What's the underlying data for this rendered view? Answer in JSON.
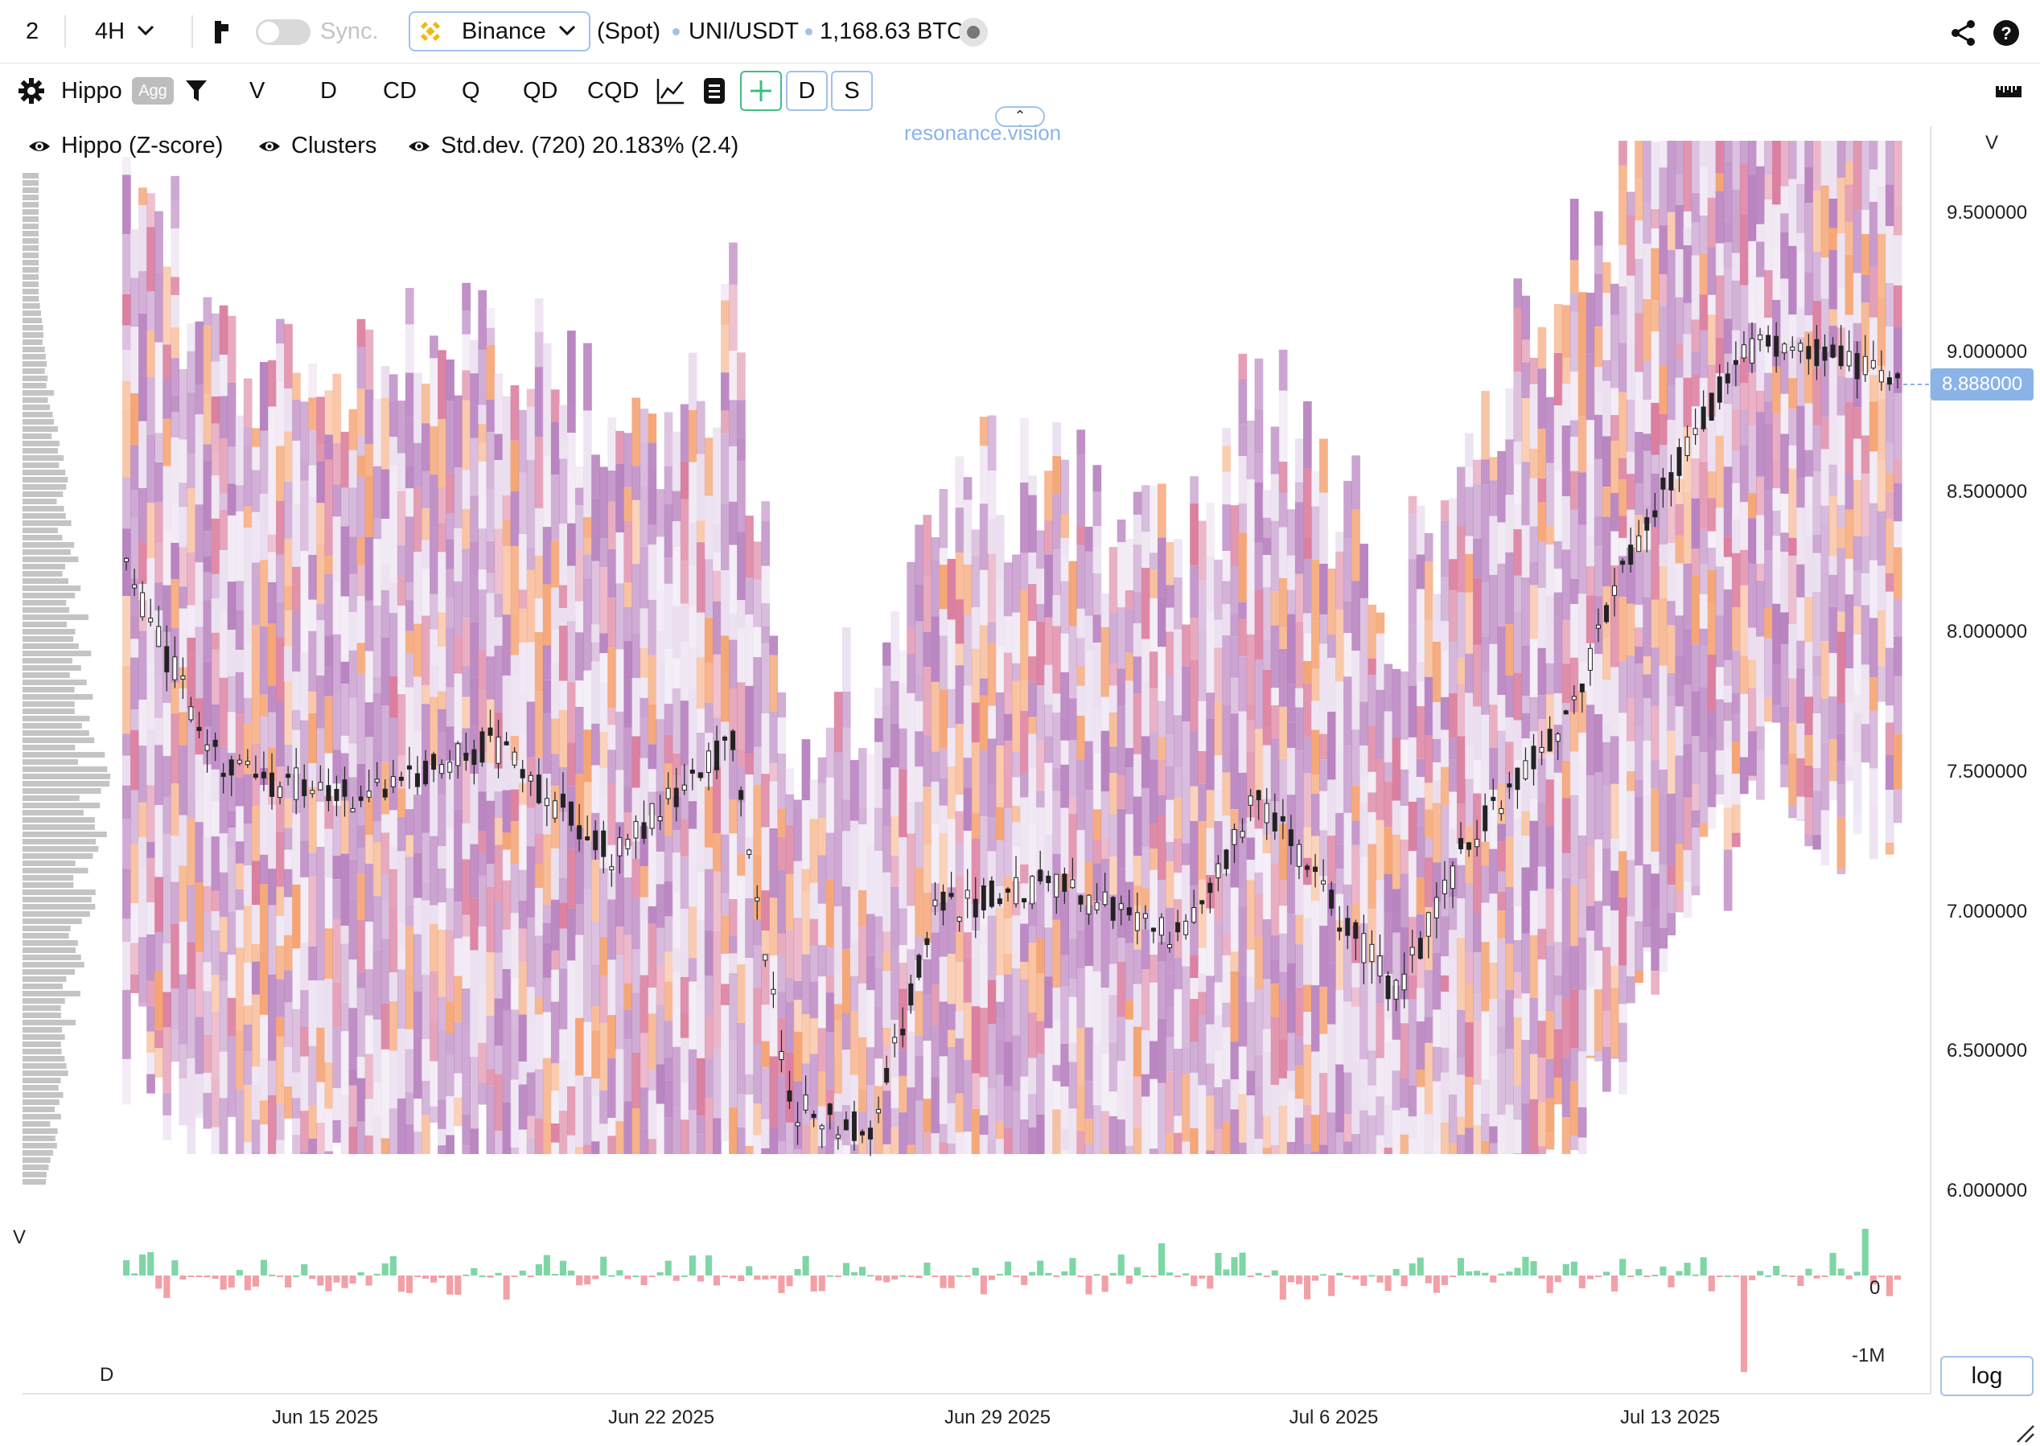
{
  "topbar": {
    "layout_count": "2",
    "interval": "4H",
    "sync_label": "Sync.",
    "exchange": "Binance",
    "market": "(Spot)",
    "pair": "UNI/USDT",
    "volume": "1,168.63 BTC"
  },
  "toolbar": {
    "indicator": "Hippo",
    "agg_badge": "Agg",
    "buttons": [
      "V",
      "D",
      "CD",
      "Q",
      "QD",
      "CQD"
    ],
    "toggle_d": "D",
    "toggle_s": "S"
  },
  "legend": {
    "hippo": "Hippo (Z-score)",
    "clusters": "Clusters",
    "stddev": "Std.dev. (720) 20.183% (2.4)"
  },
  "watermark": "resonance.vision",
  "chart": {
    "price_axis_label": "V",
    "price_ticks": [
      "9.500000",
      "9.000000",
      "8.500000",
      "8.000000",
      "7.500000",
      "7.000000",
      "6.500000",
      "6.000000"
    ],
    "current_price": "8.888000",
    "volume_profile_label": "V",
    "delta_label": "D",
    "delta_ticks": [
      "0",
      "-1M"
    ],
    "date_ticks": [
      "Jun 15 2025",
      "Jun 22 2025",
      "Jun 29 2025",
      "Jul 6 2025",
      "Jul 13 2025"
    ],
    "log_button": "log"
  },
  "colors": {
    "accent_border": "#9fc2ea",
    "price_tag": "#8ab4e8",
    "heat_low": "#e9dcee",
    "heat_mid": "#b57dbd",
    "heat_high": "#d9789a",
    "heat_peak": "#f4a06e",
    "delta_pos": "#7ed6a5",
    "delta_neg": "#f2a0a6"
  }
}
